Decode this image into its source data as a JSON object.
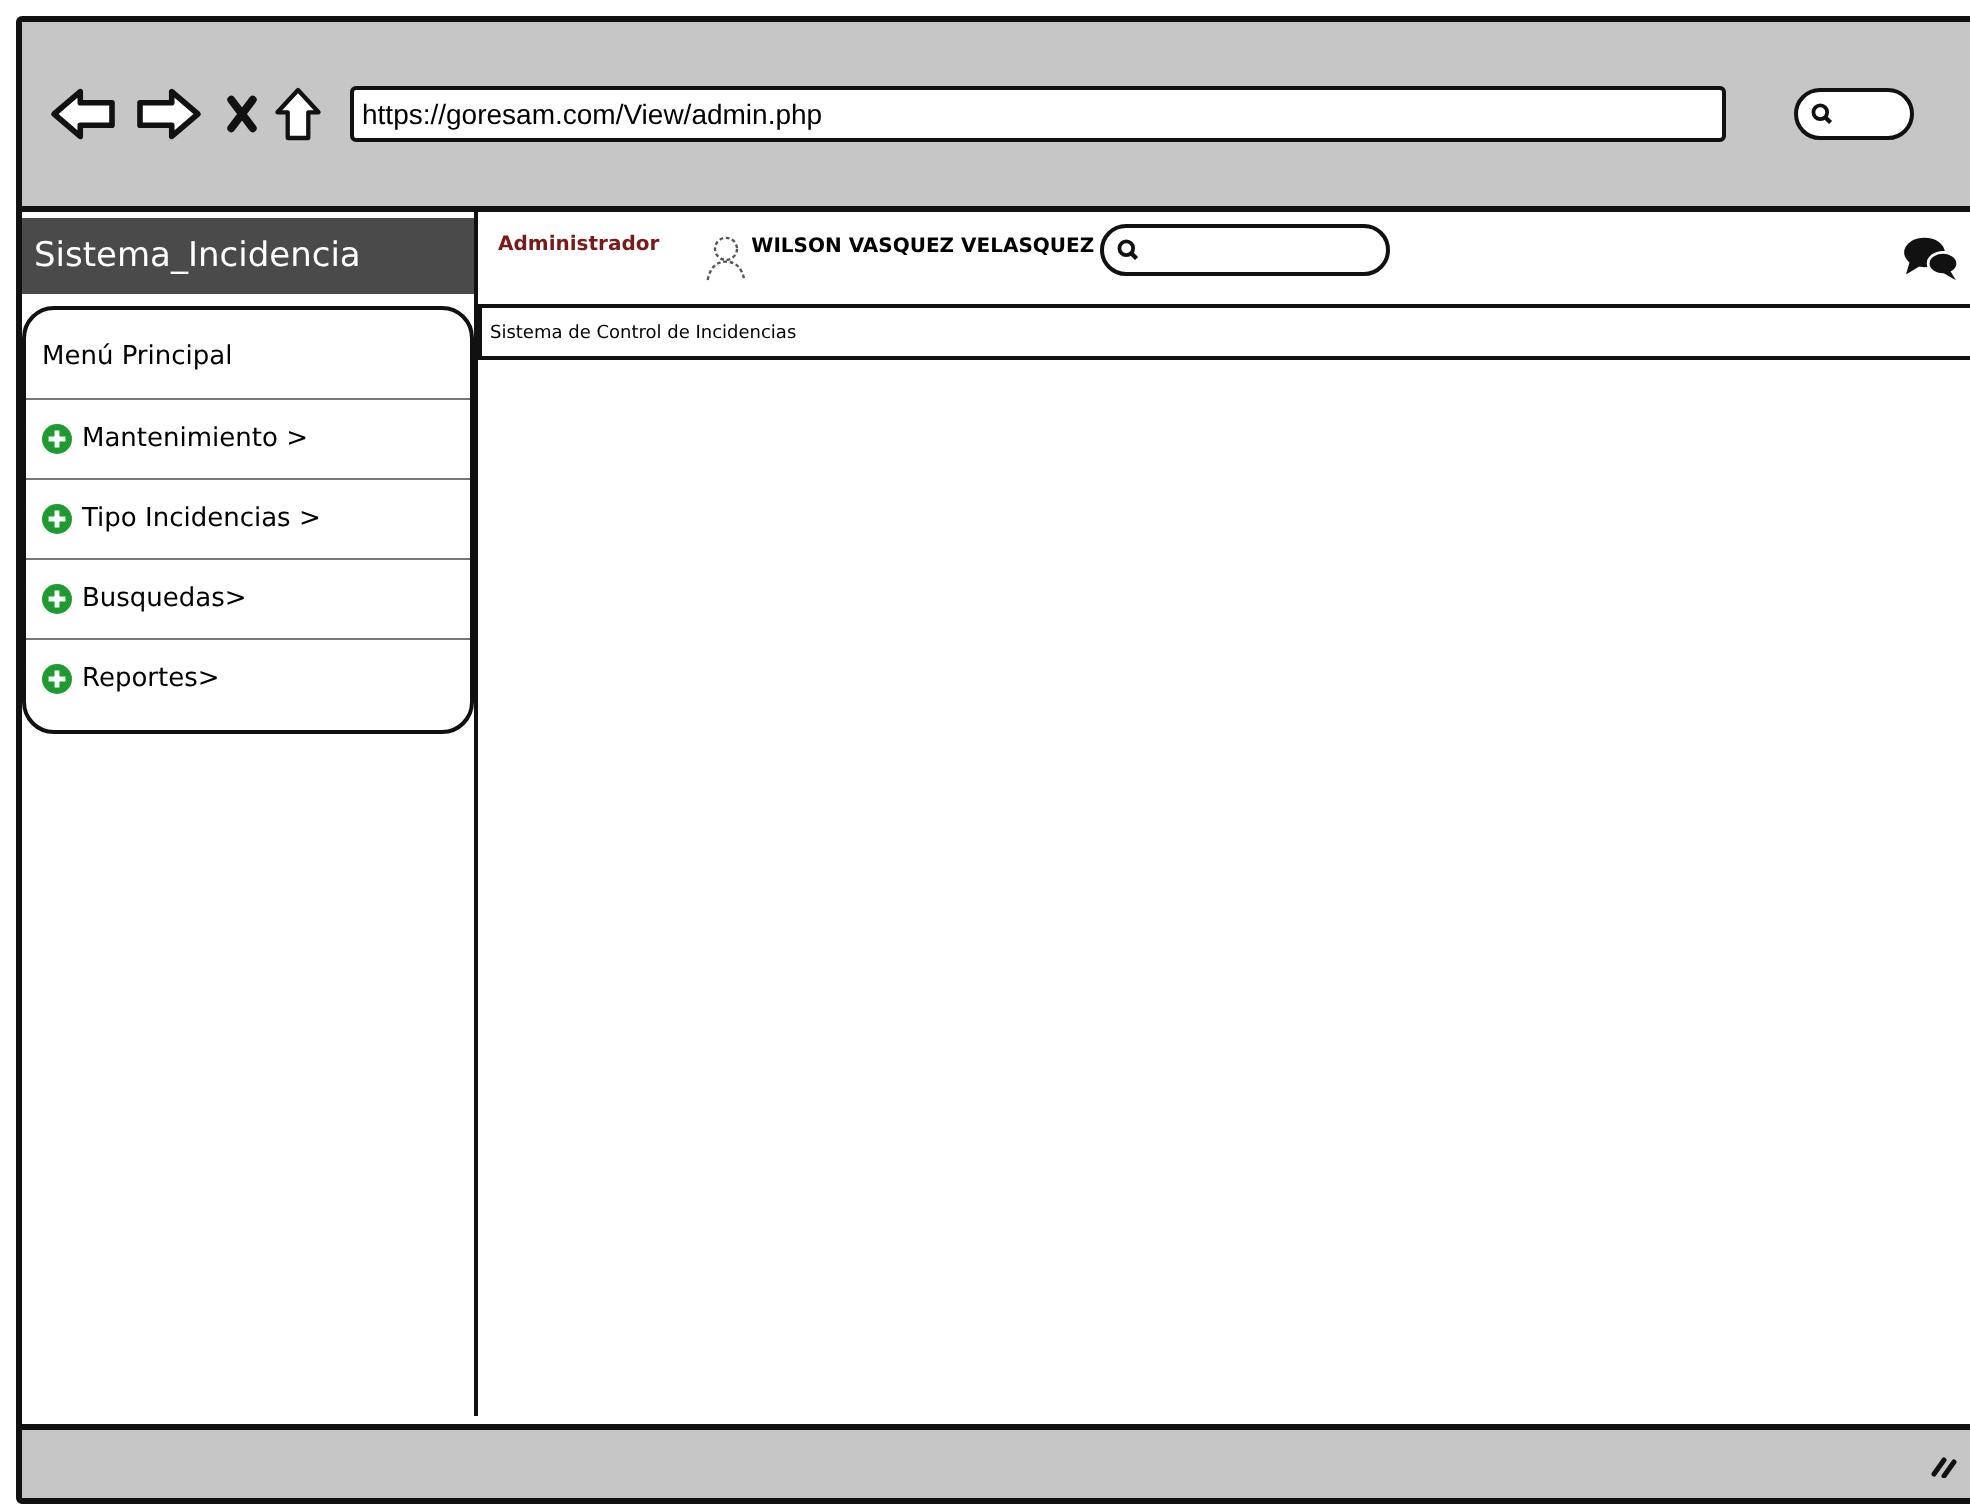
{
  "browser": {
    "url": "https://goresam.com/View/admin.php"
  },
  "sidebar": {
    "title": "Sistema_Incidencia",
    "menu_header": "Menú Principal",
    "items": [
      {
        "label": "Mantenimiento >"
      },
      {
        "label": "Tipo Incidencias >"
      },
      {
        "label": "Busquedas>"
      },
      {
        "label": "Reportes>"
      }
    ]
  },
  "header": {
    "role": "Administrador",
    "user": "WILSON VASQUEZ VELASQUEZ"
  },
  "breadcrumb": "Sistema de Control de Incidencias"
}
